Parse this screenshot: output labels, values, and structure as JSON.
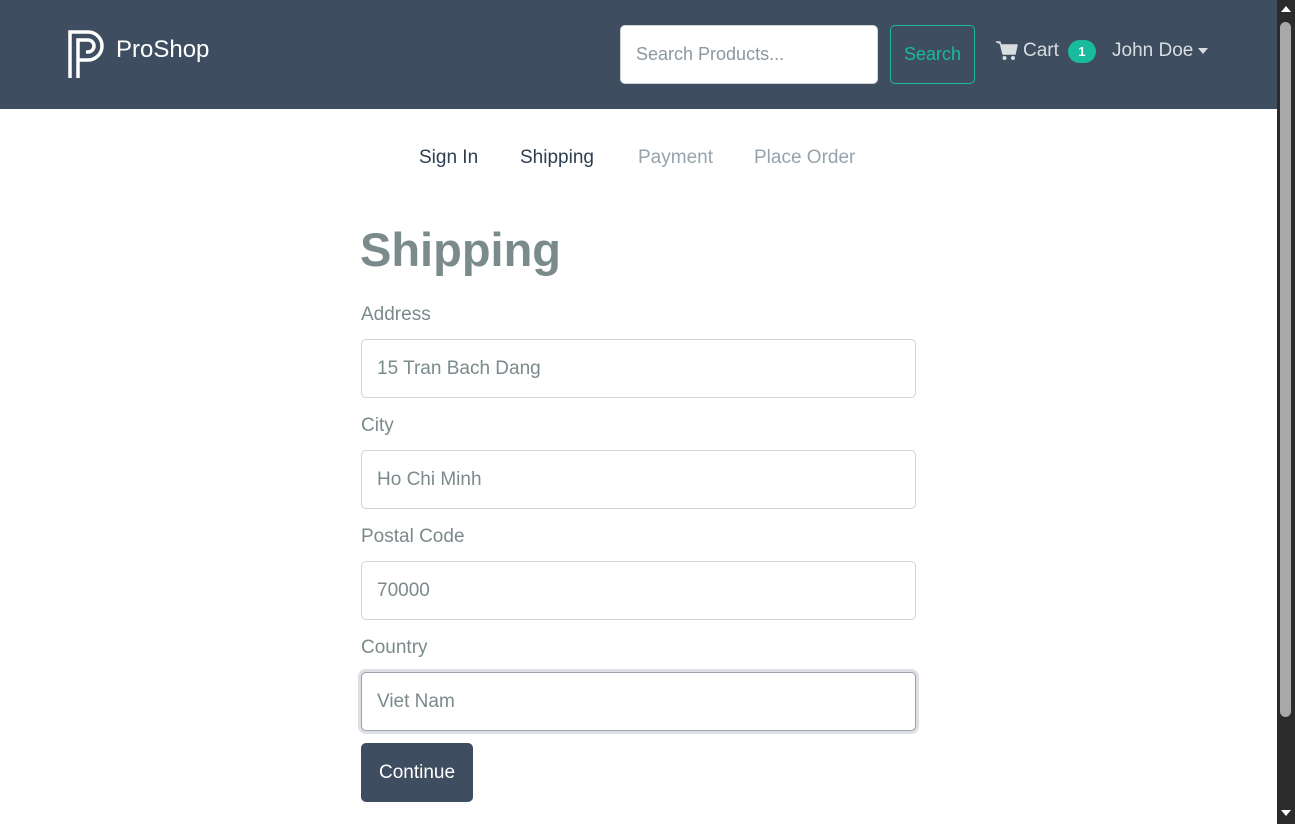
{
  "header": {
    "brand": "ProShop",
    "search": {
      "placeholder": "Search Products...",
      "value": "",
      "button_label": "Search"
    },
    "cart": {
      "label": "Cart",
      "count": "1"
    },
    "user": {
      "name": "John Doe"
    },
    "colors": {
      "navbar": "#3e4d5f",
      "accent": "#18bc9c"
    }
  },
  "steps": [
    {
      "label": "Sign In",
      "state": "active"
    },
    {
      "label": "Shipping",
      "state": "active"
    },
    {
      "label": "Payment",
      "state": "disabled"
    },
    {
      "label": "Place Order",
      "state": "disabled"
    }
  ],
  "form": {
    "title": "Shipping",
    "fields": [
      {
        "label": "Address",
        "value": "15 Tran Bach Dang"
      },
      {
        "label": "City",
        "value": "Ho Chi Minh"
      },
      {
        "label": "Postal Code",
        "value": "70000"
      },
      {
        "label": "Country",
        "value": "Viet Nam",
        "focused": true
      }
    ],
    "submit_label": "Continue"
  },
  "icons": [
    "brand-logo-icon",
    "cart-icon",
    "caret-down-icon",
    "scroll-up-icon",
    "scroll-down-icon"
  ]
}
